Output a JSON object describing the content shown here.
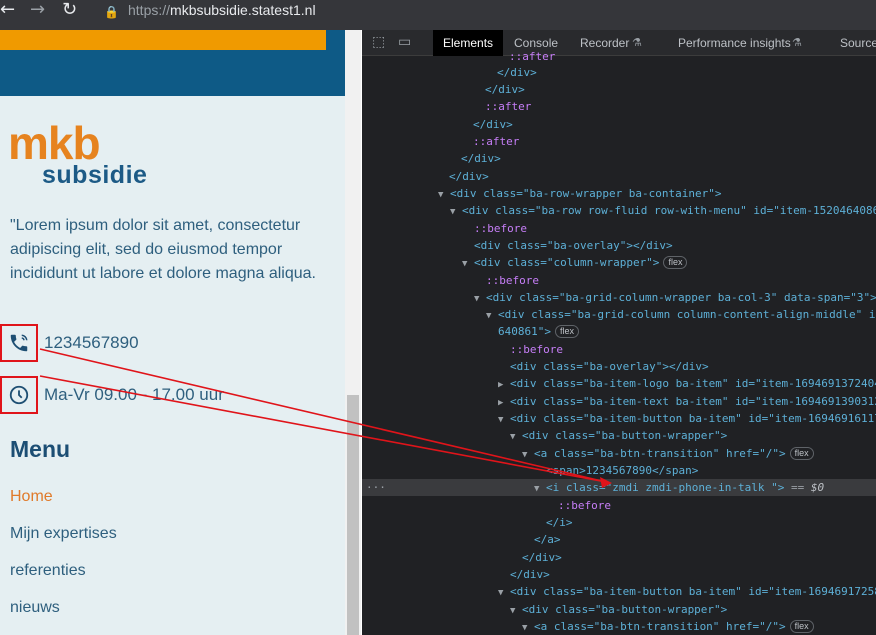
{
  "browser": {
    "url_protocol": "https://",
    "url_host": "mkbsubsidie.statest1.nl"
  },
  "site": {
    "logo_top": "mkb",
    "logo_bottom": "subsidie",
    "lorem": "\"Lorem ipsum dolor sit amet, consectetur adipiscing elit, sed do eiusmod tempor incididunt ut labore et dolore magna aliqua.",
    "phone": "1234567890",
    "hours": "Ma-Vr 09.00 - 17.00 uur",
    "menu_title": "Menu",
    "menu_items": [
      "Home",
      "Mijn expertises",
      "referenties",
      "nieuws"
    ],
    "colors": {
      "orange": "#f09a00",
      "blue": "#0e5a86",
      "highlight_box": "#e0141a"
    }
  },
  "devtools": {
    "tabs": [
      "Elements",
      "Console",
      "Recorder",
      "Performance insights",
      "Source"
    ],
    "badge_flex": "flex",
    "selected_suffix_eq": "==",
    "selected_suffix_var": "$0",
    "lines": [
      {
        "indent": 0,
        "html": "::after"
      },
      {
        "indent": 0,
        "html": "</div>"
      },
      {
        "indent": 0,
        "html": "</div>"
      },
      {
        "indent": 0,
        "html": "::after"
      },
      {
        "indent": 0,
        "html": "</div>"
      },
      {
        "indent": 0,
        "html": "::after"
      },
      {
        "indent": 0,
        "html": "</div>"
      },
      {
        "indent": 0,
        "html": "</div>"
      },
      {
        "indent": 0,
        "html": "<div class=\"ba-row-wrapper ba-container\">"
      },
      {
        "indent": 0,
        "html": "<div class=\"ba-row row-fluid row-with-menu\" id=\"item-1520464086"
      },
      {
        "indent": 0,
        "html": "::before"
      },
      {
        "indent": 0,
        "html": "<div class=\"ba-overlay\"></div>"
      },
      {
        "indent": 0,
        "html": "<div class=\"column-wrapper\">"
      },
      {
        "indent": 0,
        "html": "::before"
      },
      {
        "indent": 0,
        "html": "<div class=\"ba-grid-column-wrapper ba-col-3\" data-span=\"3\">"
      },
      {
        "indent": 0,
        "html": "<div class=\"ba-grid-column column-content-align-middle\" id"
      },
      {
        "indent": 0,
        "html": "640861\">"
      },
      {
        "indent": 0,
        "html": "::before"
      },
      {
        "indent": 0,
        "html": "<div class=\"ba-overlay\"></div>"
      },
      {
        "indent": 0,
        "html": "<div class=\"ba-item-logo ba-item\" id=\"item-1694691372404"
      },
      {
        "indent": 0,
        "html": "<div class=\"ba-item-text ba-item\" id=\"item-1694691390312"
      },
      {
        "indent": 0,
        "html": "<div class=\"ba-item-button ba-item\" id=\"item-16946916117"
      },
      {
        "indent": 0,
        "html": "<div class=\"ba-button-wrapper\">"
      },
      {
        "indent": 0,
        "html": "<a class=\"ba-btn-transition\" href=\"/\">"
      },
      {
        "indent": 0,
        "html": "<span>1234567890</span>"
      },
      {
        "indent": 0,
        "html": "<i class=\"zmdi zmdi-phone-in-talk \">"
      },
      {
        "indent": 0,
        "html": "::before"
      },
      {
        "indent": 0,
        "html": "</i>"
      },
      {
        "indent": 0,
        "html": "</a>"
      },
      {
        "indent": 0,
        "html": "</div>"
      },
      {
        "indent": 0,
        "html": "</div>"
      },
      {
        "indent": 0,
        "html": "<div class=\"ba-item-button ba-item\" id=\"item-16946917258"
      },
      {
        "indent": 0,
        "html": "<div class=\"ba-button-wrapper\">"
      },
      {
        "indent": 0,
        "html": "<a class=\"ba-btn-transition\" href=\"/\">"
      }
    ]
  }
}
